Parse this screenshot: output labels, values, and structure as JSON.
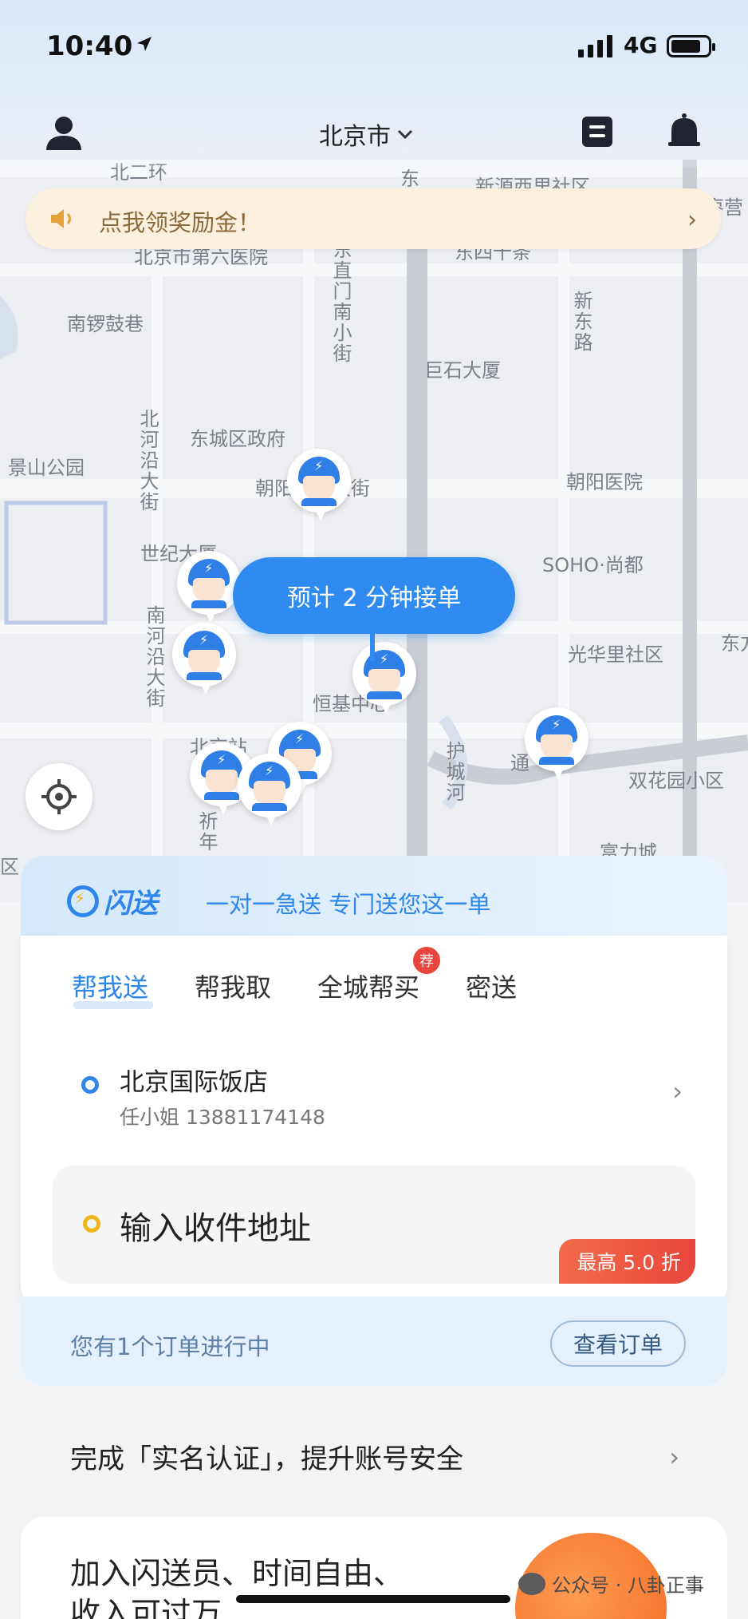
{
  "status_bar": {
    "time": "10:40",
    "network": "4G"
  },
  "topbar": {
    "city": "北京市"
  },
  "reward_banner": {
    "text": "点我领奖励金！"
  },
  "map": {
    "labels": [
      "北二环",
      "东",
      "新源西里社区",
      "枣营",
      "北京市第六医院",
      "东直门南小街",
      "东四十条",
      "南锣鼓巷",
      "巨石大厦",
      "新东路",
      "北河沿大街",
      "东城区政府",
      "景山公园",
      "朝阳门内大街",
      "朝阳医院",
      "世纪大厦",
      "SOHO·尚都",
      "南河沿大街",
      "光华里社区",
      "东方",
      "恒基中心",
      "北京站",
      "护城河",
      "通",
      "双花园小区",
      "祈年",
      "富力城",
      "区"
    ],
    "eta": "预计 2 分钟接单"
  },
  "card": {
    "brand": "闪送",
    "slogan": "一对一急送 专门送您这一单",
    "tabs": [
      "帮我送",
      "帮我取",
      "全城帮买",
      "密送"
    ],
    "recommend_badge": "荐",
    "sender_name": "北京国际饭店",
    "sender_contact": "任小姐 13881174148",
    "receiver_placeholder": "输入收件地址",
    "discount": "最高 5.0 折"
  },
  "order_progress": {
    "text": "您有1个订单进行中",
    "button": "查看订单"
  },
  "verify": {
    "text": "完成「实名认证」，提升账号安全"
  },
  "join": {
    "line1": "加入闪送员、时间自由、",
    "line2": "收入可过万"
  },
  "watermark": {
    "text": "公众号 · 八卦正事"
  }
}
